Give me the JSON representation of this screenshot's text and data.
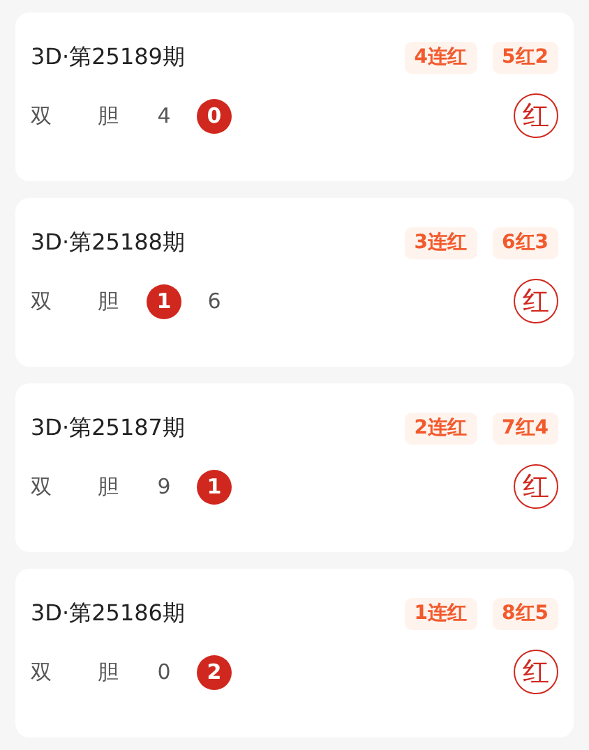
{
  "cards": [
    {
      "title": "3D·第25189期",
      "badges": [
        "4连红",
        "5红2"
      ],
      "labels": [
        "双",
        "胆"
      ],
      "numbers": [
        {
          "value": "4",
          "hit": false
        },
        {
          "value": "0",
          "hit": true
        }
      ],
      "stamp": "红"
    },
    {
      "title": "3D·第25188期",
      "badges": [
        "3连红",
        "6红3"
      ],
      "labels": [
        "双",
        "胆"
      ],
      "numbers": [
        {
          "value": "1",
          "hit": true
        },
        {
          "value": "6",
          "hit": false
        }
      ],
      "stamp": "红"
    },
    {
      "title": "3D·第25187期",
      "badges": [
        "2连红",
        "7红4"
      ],
      "labels": [
        "双",
        "胆"
      ],
      "numbers": [
        {
          "value": "9",
          "hit": false
        },
        {
          "value": "1",
          "hit": true
        }
      ],
      "stamp": "红"
    },
    {
      "title": "3D·第25186期",
      "badges": [
        "1连红",
        "8红5"
      ],
      "labels": [
        "双",
        "胆"
      ],
      "numbers": [
        {
          "value": "0",
          "hit": false
        },
        {
          "value": "2",
          "hit": true
        }
      ],
      "stamp": "红"
    }
  ]
}
